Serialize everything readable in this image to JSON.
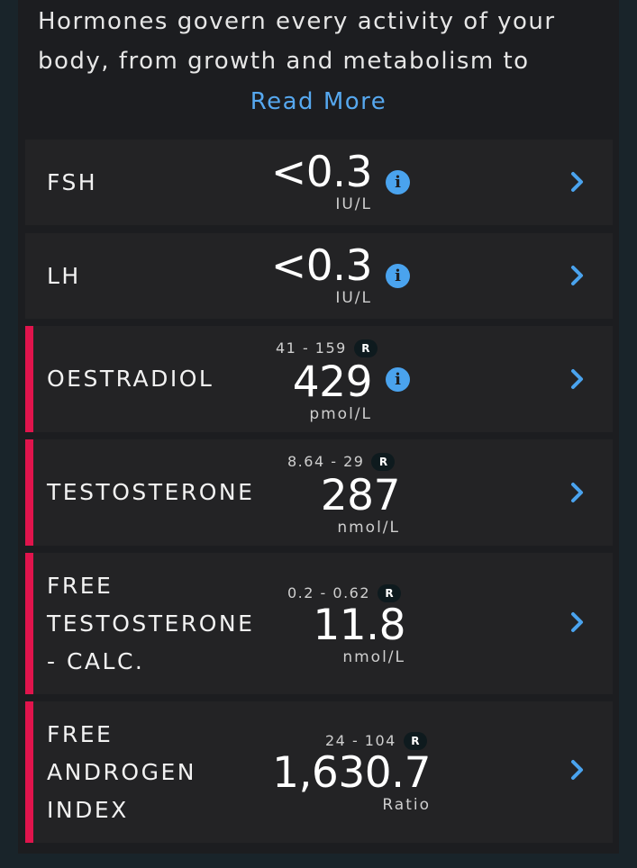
{
  "intro": {
    "line1": "Hormones govern every activity of your",
    "line2": "body, from growth and metabolism to",
    "read_more": "Read More"
  },
  "colors": {
    "flag": "#e0144c",
    "accent": "#4aa3ee",
    "link": "#56a8ef"
  },
  "results": [
    {
      "name": "FSH",
      "value": "<0.3",
      "unit": "IU/L",
      "info": "i",
      "flagged": false
    },
    {
      "name": "LH",
      "value": "<0.3",
      "unit": "IU/L",
      "info": "i",
      "flagged": false
    },
    {
      "name": "OESTRADIOL",
      "range": "41 - 159",
      "range_badge": "R",
      "value": "429",
      "unit": "pmol/L",
      "info": "i",
      "flagged": true
    },
    {
      "name": "TESTOSTERONE",
      "range": "8.64 - 29",
      "range_badge": "R",
      "value": "287",
      "unit": "nmol/L",
      "flagged": true
    },
    {
      "name": "FREE\nTESTOSTERONE\n- CALC.",
      "range": "0.2 - 0.62",
      "range_badge": "R",
      "value": "11.8",
      "unit": "nmol/L",
      "flagged": true
    },
    {
      "name": "FREE\nANDROGEN\nINDEX",
      "range": "24 - 104",
      "range_badge": "R",
      "value": "1,630.7",
      "unit": "Ratio",
      "flagged": true
    }
  ]
}
